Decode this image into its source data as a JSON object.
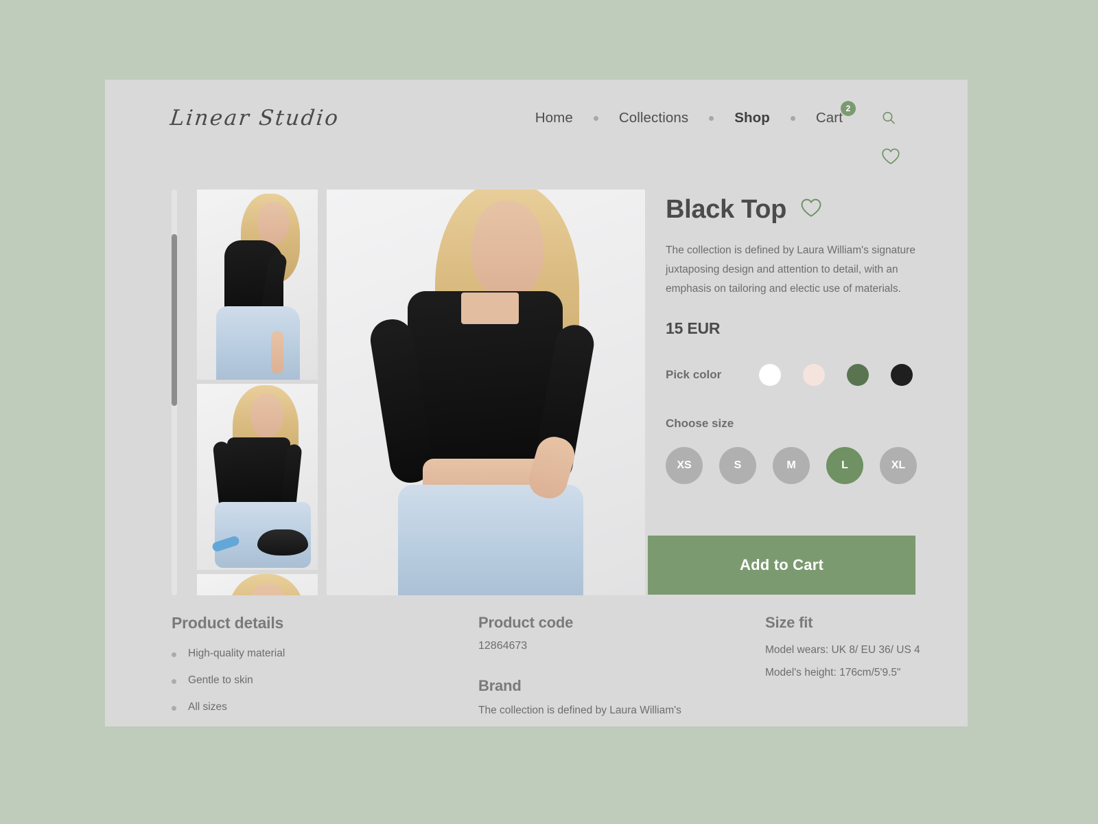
{
  "brand": {
    "logo": "Linear Studio"
  },
  "nav": {
    "items": [
      {
        "label": "Home",
        "active": false
      },
      {
        "label": "Collections",
        "active": false
      },
      {
        "label": "Shop",
        "active": true
      },
      {
        "label": "Cart",
        "active": false
      }
    ],
    "cart_badge": "2",
    "search_icon": "search-icon",
    "wishlist_icon": "heart-icon"
  },
  "product": {
    "title": "Black Top",
    "favorite_icon": "heart-icon",
    "description": "The collection is defined by Laura William's signature juxtaposing design and attention to detail, with an emphasis on tailoring and\nelectic use of materials.",
    "price": "15 EUR",
    "color_label": "Pick color",
    "colors": [
      {
        "name": "white",
        "hex": "#ffffff"
      },
      {
        "name": "blush",
        "hex": "#f5e4dd"
      },
      {
        "name": "green",
        "hex": "#5a7452"
      },
      {
        "name": "black",
        "hex": "#1f1f1f"
      }
    ],
    "size_label": "Choose size",
    "sizes": [
      {
        "label": "XS",
        "selected": false
      },
      {
        "label": "S",
        "selected": false
      },
      {
        "label": "M",
        "selected": false
      },
      {
        "label": "L",
        "selected": true
      },
      {
        "label": "XL",
        "selected": false
      }
    ],
    "add_to_cart": "Add to Cart"
  },
  "gallery": {
    "thumbnails": [
      "model-side-view-black-crop-top",
      "model-seated-with-black-clutch-bag",
      "model-close-up-face"
    ],
    "main_image": "model-front-view-black-square-neck-crop-top"
  },
  "details": {
    "heading": "Product details",
    "bullets": [
      "High-quality material",
      "Gentle to skin",
      "All sizes"
    ]
  },
  "code": {
    "heading": "Product code",
    "value": "12864673",
    "brand_heading": "Brand",
    "brand_text": "The collection is defined by Laura William's"
  },
  "fit": {
    "heading": "Size fit",
    "model_wears": "Model wears: UK 8/ EU 36/ US 4",
    "model_height": "Model's height: 176cm/5'9.5\""
  },
  "theme": {
    "page_bg": "#bfcbbb",
    "card_bg": "#d9d9d9",
    "accent_green": "#7b9a70",
    "selected_green": "#6f9164",
    "text_gray": "#6d6d6d"
  }
}
